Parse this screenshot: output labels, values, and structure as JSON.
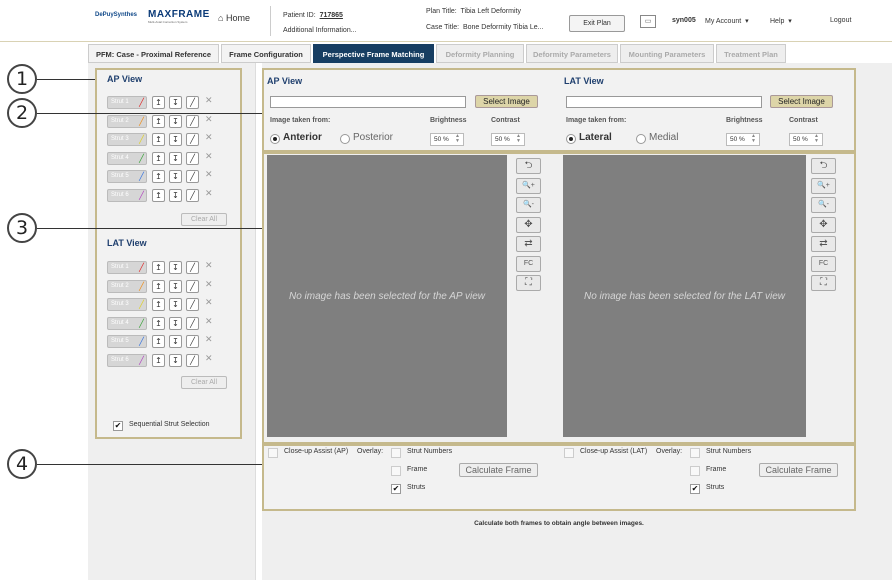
{
  "header": {
    "brand_left": "DePuySynthes",
    "brand_main": "MAXFRAME",
    "brand_sub": "Multi-Axial Correction System",
    "home": "Home",
    "patient_id_label": "Patient ID:",
    "patient_id": "717865",
    "additional_info": "Additional Information...",
    "plan_title_label": "Plan Title:",
    "plan_title": "Tibia Left Deformity",
    "case_title_label": "Case Title:",
    "case_title": "Bone Deformity Tibia Le...",
    "exit_plan": "Exit Plan",
    "username": "syn005",
    "my_account": "My Account",
    "help": "Help",
    "logout": "Logout"
  },
  "tabs": [
    {
      "label": "PFM: Case - Proximal Reference",
      "state": "done"
    },
    {
      "label": "Frame Configuration",
      "state": "done"
    },
    {
      "label": "Perspective Frame Matching",
      "state": "active"
    },
    {
      "label": "Deformity Planning",
      "state": "disabled"
    },
    {
      "label": "Deformity Parameters",
      "state": "disabled"
    },
    {
      "label": "Mounting Parameters",
      "state": "disabled"
    },
    {
      "label": "Treatment Plan",
      "state": "disabled"
    }
  ],
  "sidebar": {
    "ap_title": "AP View",
    "lat_title": "LAT View",
    "struts": [
      "Strut 1",
      "Strut 2",
      "Strut 3",
      "Strut 4",
      "Strut 5",
      "Strut 6"
    ],
    "strut_colors": [
      "#e02020",
      "#f08a10",
      "#e0d020",
      "#30a030",
      "#3070e0",
      "#b040c0"
    ],
    "clear_all": "Clear All",
    "sequential": "Sequential Strut Selection",
    "sequential_checked": true
  },
  "ap": {
    "title": "AP View",
    "select_image": "Select Image",
    "taken_from": "Image taken from:",
    "brightness_label": "Brightness",
    "contrast_label": "Contrast",
    "opt1": "Anterior",
    "opt2": "Posterior",
    "brightness": "50 %",
    "contrast": "50 %",
    "empty_msg": "No image has been selected for the AP view",
    "closeup": "Close-up Assist (AP)",
    "overlay": "Overlay:",
    "strut_numbers": "Strut Numbers",
    "frame": "Frame",
    "struts": "Struts",
    "calc_frame": "Calculate Frame"
  },
  "lat": {
    "title": "LAT View",
    "select_image": "Select Image",
    "taken_from": "Image taken from:",
    "brightness_label": "Brightness",
    "contrast_label": "Contrast",
    "opt1": "Lateral",
    "opt2": "Medial",
    "brightness": "50 %",
    "contrast": "50 %",
    "empty_msg": "No image has been selected for the LAT view",
    "closeup": "Close-up Assist (LAT)",
    "overlay": "Overlay:",
    "strut_numbers": "Strut Numbers",
    "frame": "Frame",
    "struts": "Struts",
    "calc_frame": "Calculate Frame"
  },
  "tools": [
    {
      "icon": "undo-icon",
      "glyph": "⮌"
    },
    {
      "icon": "zoom-in-icon",
      "glyph": "🔍+"
    },
    {
      "icon": "zoom-out-icon",
      "glyph": "🔍-"
    },
    {
      "icon": "pan-icon",
      "glyph": "✥"
    },
    {
      "icon": "refresh-icon",
      "glyph": "⇄"
    },
    {
      "icon": "fc-icon",
      "glyph": "FC"
    },
    {
      "icon": "fit-icon",
      "glyph": "⛶"
    }
  ],
  "footer_msg": "Calculate both frames to obtain angle between images.",
  "callouts": [
    "1",
    "2",
    "3",
    "4"
  ]
}
